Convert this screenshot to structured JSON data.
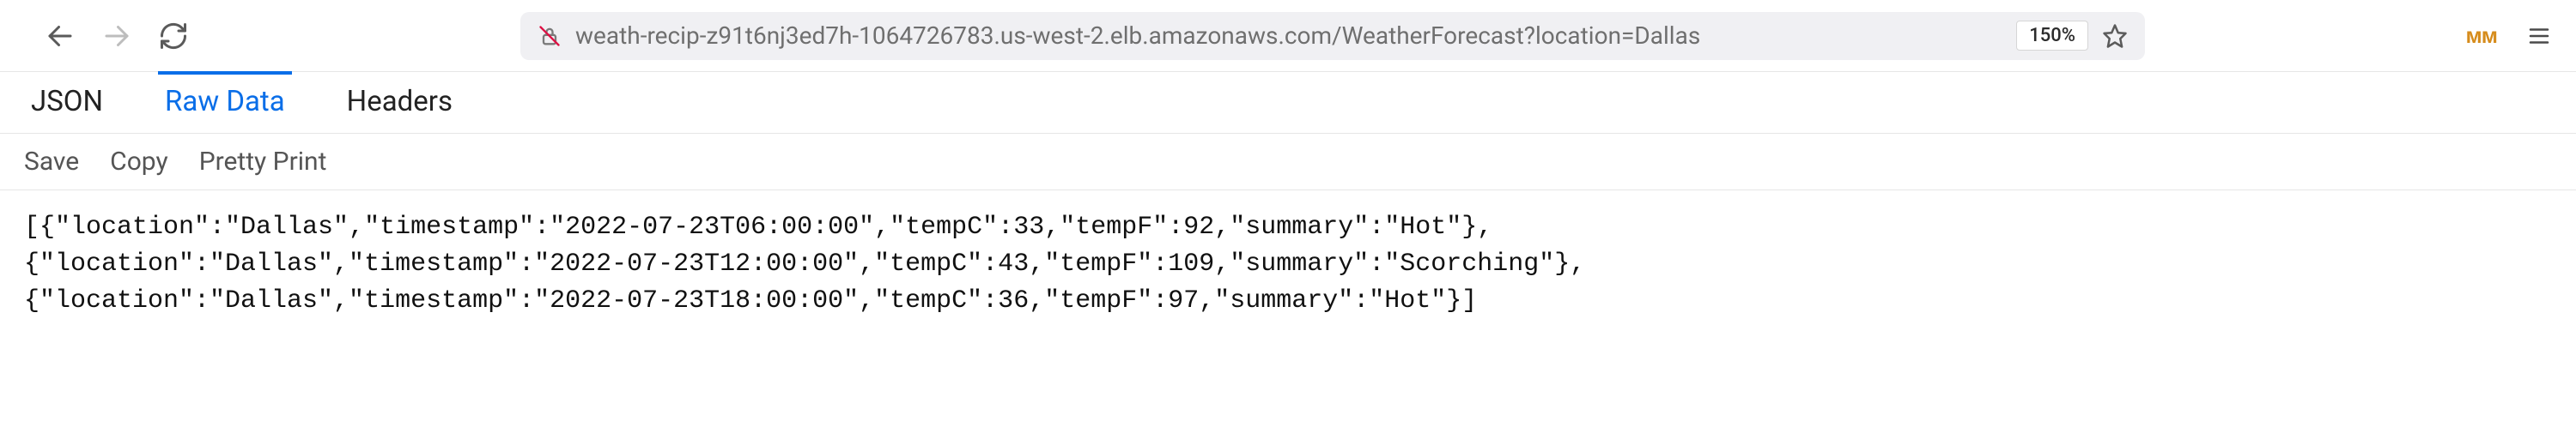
{
  "toolbar": {
    "url": "weath-recip-z91t6nj3ed7h-1064726783.us-west-2.elb.amazonaws.com/WeatherForecast?location=Dallas",
    "zoom": "150%"
  },
  "tabs": {
    "json": "JSON",
    "raw": "Raw Data",
    "headers": "Headers"
  },
  "actions": {
    "save": "Save",
    "copy": "Copy",
    "pretty": "Pretty Print"
  },
  "raw_body": "[{\"location\":\"Dallas\",\"timestamp\":\"2022-07-23T06:00:00\",\"tempC\":33,\"tempF\":92,\"summary\":\"Hot\"},\n{\"location\":\"Dallas\",\"timestamp\":\"2022-07-23T12:00:00\",\"tempC\":43,\"tempF\":109,\"summary\":\"Scorching\"},\n{\"location\":\"Dallas\",\"timestamp\":\"2022-07-23T18:00:00\",\"tempC\":36,\"tempF\":97,\"summary\":\"Hot\"}]"
}
